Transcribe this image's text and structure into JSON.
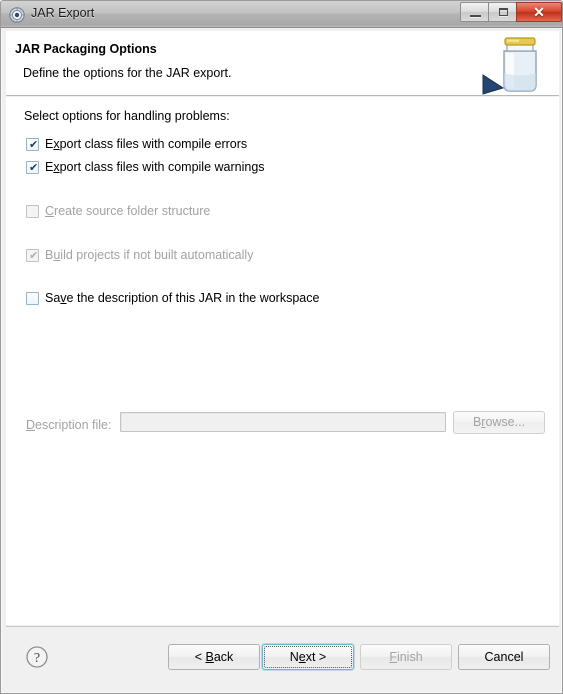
{
  "window": {
    "title": "JAR Export",
    "icon": "jar-export-icon",
    "controls": {
      "minimize": "minimize-icon",
      "maximize": "maximize-icon",
      "close": "✕"
    }
  },
  "header": {
    "title": "JAR Packaging Options",
    "description": "Define the options for the JAR export.",
    "art": "jar-export-banner-icon"
  },
  "content": {
    "section_label": "Select options for handling problems:",
    "options": [
      {
        "label_pre": "E",
        "label_mnemonic": "x",
        "label_post": "port class files with compile errors",
        "checked": true,
        "enabled": true,
        "name": "export-class-files-with-compile-errors"
      },
      {
        "label_pre": "E",
        "label_mnemonic": "x",
        "label_post": "port class files with compile warnings",
        "checked": true,
        "enabled": true,
        "name": "export-class-files-with-compile-warnings"
      },
      {
        "label_pre": "",
        "label_mnemonic": "C",
        "label_post": "reate source folder structure",
        "checked": false,
        "enabled": false,
        "name": "create-source-folder-structure"
      },
      {
        "label_pre": "B",
        "label_mnemonic": "u",
        "label_post": "ild projects if not built automatically",
        "checked": true,
        "enabled": false,
        "name": "build-projects-if-not-built-automatically"
      },
      {
        "label_pre": "Sa",
        "label_mnemonic": "v",
        "label_post": "e the description of this JAR in the workspace",
        "checked": false,
        "enabled": true,
        "name": "save-the-description-of-this-jar-in-the-workspace"
      }
    ],
    "description_file": {
      "label_pre": "",
      "label_mnemonic": "D",
      "label_post": "escription file:",
      "value": "",
      "placeholder": "",
      "enabled": false
    },
    "browse_button": {
      "label_pre": "B",
      "label_mnemonic": "r",
      "label_post": "owse...",
      "enabled": false
    }
  },
  "footer": {
    "help": "?",
    "buttons": [
      {
        "pre": "< ",
        "mnemonic": "B",
        "post": "ack",
        "enabled": true,
        "focused": false,
        "name": "back-button"
      },
      {
        "pre": "N",
        "mnemonic": "e",
        "post": "xt >",
        "enabled": true,
        "focused": true,
        "name": "next-button"
      },
      {
        "pre": "",
        "mnemonic": "F",
        "post": "inish",
        "enabled": false,
        "focused": false,
        "name": "finish-button"
      },
      {
        "pre": "Cancel",
        "mnemonic": "",
        "post": "",
        "enabled": true,
        "focused": false,
        "name": "cancel-button"
      }
    ]
  },
  "colors": {
    "accent_focus": "#6fb5cd",
    "close_button": "#d5422a",
    "disabled_text": "#a3a3a3",
    "content_bg": "#ffffff",
    "chrome_bg": "#f0f0f0"
  }
}
